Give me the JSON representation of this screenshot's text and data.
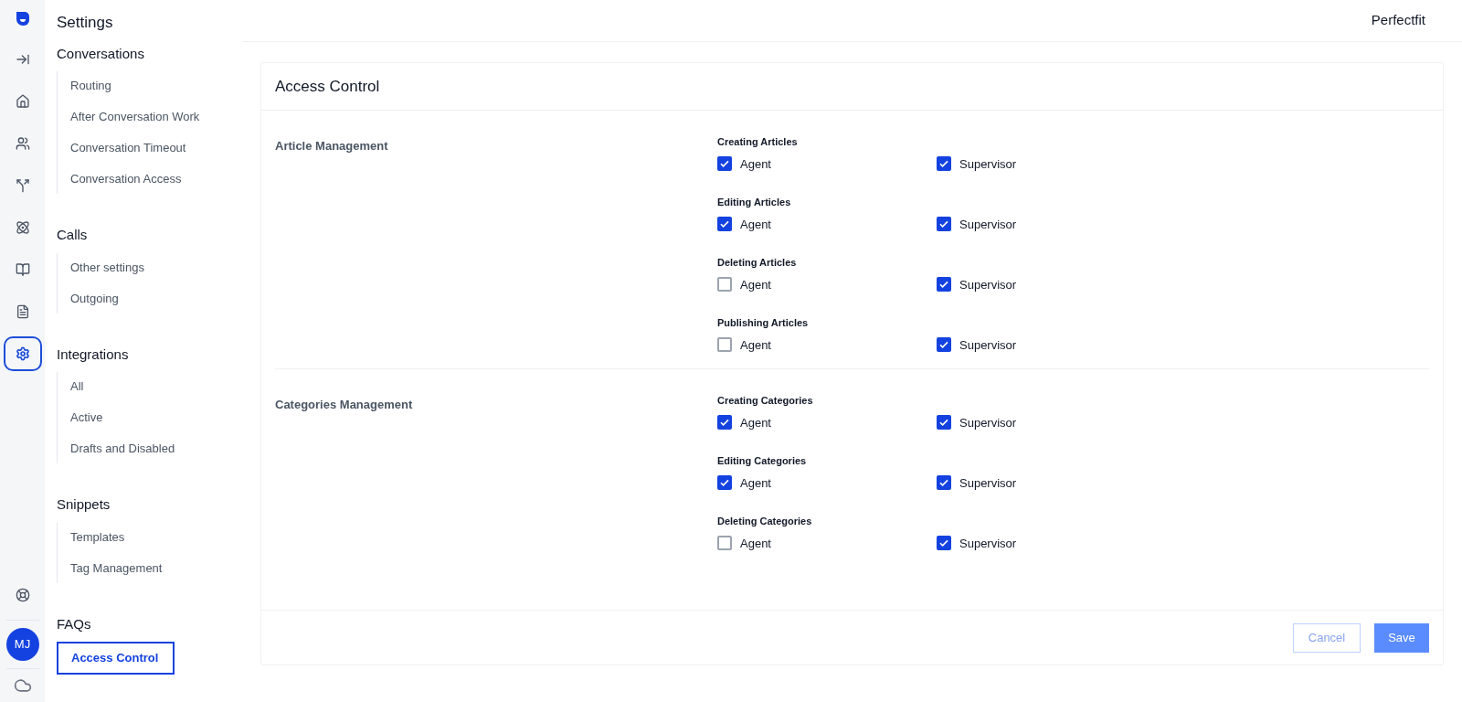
{
  "rail": {
    "top": [
      {
        "selected": false
      },
      {
        "selected": false
      },
      {
        "selected": false
      },
      {
        "selected": false
      },
      {
        "selected": false
      },
      {
        "selected": false
      },
      {
        "selected": false
      },
      {
        "selected": true
      }
    ],
    "avatar": "MJ"
  },
  "sidebar": {
    "title": "Settings",
    "groups": [
      {
        "title": "Conversations",
        "items": [
          {
            "label": "Routing",
            "selected": false
          },
          {
            "label": "After Conversation Work",
            "selected": false
          },
          {
            "label": "Conversation Timeout",
            "selected": false
          },
          {
            "label": "Conversation Access",
            "selected": false
          }
        ]
      },
      {
        "title": "Calls",
        "items": [
          {
            "label": "Other settings",
            "selected": false
          },
          {
            "label": "Outgoing",
            "selected": false
          }
        ]
      },
      {
        "title": "Integrations",
        "items": [
          {
            "label": "All",
            "selected": false
          },
          {
            "label": "Active",
            "selected": false
          },
          {
            "label": "Drafts and Disabled",
            "selected": false
          }
        ]
      },
      {
        "title": "Snippets",
        "items": [
          {
            "label": "Templates",
            "selected": false
          },
          {
            "label": "Tag Management",
            "selected": false
          }
        ]
      },
      {
        "title": "FAQs",
        "items": [
          {
            "label": "Access Control",
            "selected": true
          }
        ]
      }
    ]
  },
  "header": {
    "workspace": "Perfectfit"
  },
  "card": {
    "title": "Access Control",
    "sections": [
      {
        "title": "Article Management",
        "permissions": [
          {
            "title": "Creating Articles",
            "roles": [
              {
                "label": "Agent",
                "checked": true
              },
              {
                "label": "Supervisor",
                "checked": true
              }
            ]
          },
          {
            "title": "Editing Articles",
            "roles": [
              {
                "label": "Agent",
                "checked": true
              },
              {
                "label": "Supervisor",
                "checked": true
              }
            ]
          },
          {
            "title": "Deleting Articles",
            "roles": [
              {
                "label": "Agent",
                "checked": false
              },
              {
                "label": "Supervisor",
                "checked": true
              }
            ]
          },
          {
            "title": "Publishing Articles",
            "roles": [
              {
                "label": "Agent",
                "checked": false
              },
              {
                "label": "Supervisor",
                "checked": true
              }
            ]
          }
        ]
      },
      {
        "title": "Categories Management",
        "permissions": [
          {
            "title": "Creating Categories",
            "roles": [
              {
                "label": "Agent",
                "checked": true
              },
              {
                "label": "Supervisor",
                "checked": true
              }
            ]
          },
          {
            "title": "Editing Categories",
            "roles": [
              {
                "label": "Agent",
                "checked": true
              },
              {
                "label": "Supervisor",
                "checked": true
              }
            ]
          },
          {
            "title": "Deleting Categories",
            "roles": [
              {
                "label": "Agent",
                "checked": false
              },
              {
                "label": "Supervisor",
                "checked": true
              }
            ]
          }
        ]
      }
    ],
    "buttons": [
      {
        "label": "Cancel",
        "kind": "secondary",
        "disabled": true
      },
      {
        "label": "Save",
        "kind": "primary",
        "disabled": true
      }
    ]
  }
}
